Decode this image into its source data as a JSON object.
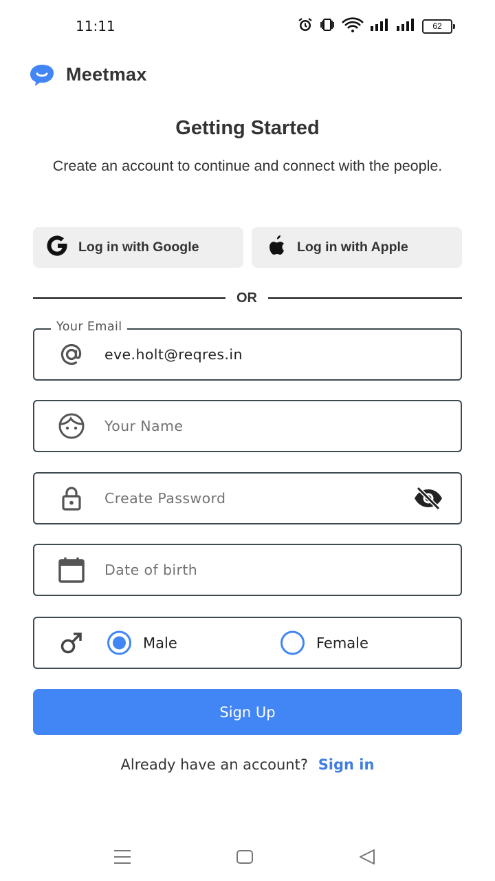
{
  "status_bar": {
    "time": "11:11",
    "battery": "62",
    "icons": [
      "alarm-icon",
      "vibrate-icon",
      "wifi-icon",
      "signal-icon",
      "signal-icon",
      "battery-icon"
    ]
  },
  "brand": {
    "name": "Meetmax",
    "logo_color": "#4285f4"
  },
  "header": {
    "title": "Getting Started",
    "subtitle": "Create an account to continue and connect with the people."
  },
  "social": {
    "google_label": "Log in with Google",
    "apple_label": "Log in with Apple"
  },
  "divider_text": "OR",
  "form": {
    "email": {
      "legend": "Your Email",
      "value": "eve.holt@reqres.in"
    },
    "name": {
      "placeholder": "Your Name"
    },
    "password": {
      "placeholder": "Create Password"
    },
    "dob": {
      "placeholder": "Date of birth"
    },
    "gender": {
      "options": [
        {
          "label": "Male",
          "selected": true
        },
        {
          "label": "Female",
          "selected": false
        }
      ]
    }
  },
  "signup_label": "Sign Up",
  "footer": {
    "prompt": "Already have an account?",
    "link": "Sign in"
  },
  "colors": {
    "accent": "#4285f4",
    "border": "#3d4a4e",
    "button_bg": "#efefef"
  }
}
